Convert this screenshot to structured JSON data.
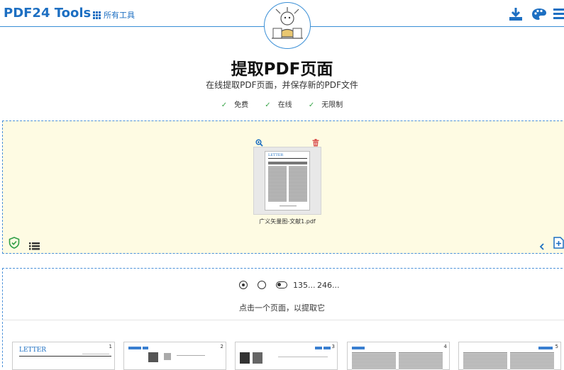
{
  "header": {
    "brand": "PDF24 Tools",
    "all_tools": "所有工具"
  },
  "main": {
    "title": "提取PDF页面",
    "subtitle": "在线提取PDF页面，并保存新的PDF文件",
    "features": [
      "免费",
      "在线",
      "无限制"
    ]
  },
  "dropzone": {
    "file_name": "广义矢量图-文献1.pdf",
    "file_preview_heading": "LETTER"
  },
  "options": {
    "range_a": "135...",
    "range_b": "246...",
    "instruction": "点击一个页面，以提取它"
  },
  "thumbnails": [
    {
      "page": "1",
      "heading": "LETTER"
    },
    {
      "page": "2",
      "heading": ""
    },
    {
      "page": "3",
      "heading": ""
    },
    {
      "page": "4",
      "heading": ""
    },
    {
      "page": "5",
      "heading": ""
    }
  ],
  "colors": {
    "brand_blue": "#1d6fc2",
    "dropzone_bg": "#fefbe3",
    "check_green": "#3aa64a",
    "trash_red": "#d9534f"
  }
}
